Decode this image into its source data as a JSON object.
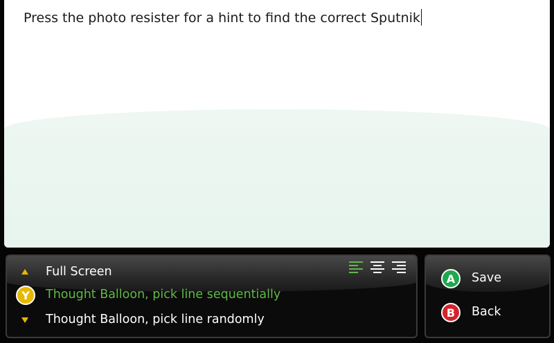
{
  "editor": {
    "text": "Press the photo resister for a hint to find the correct Sputnik"
  },
  "options": {
    "items": [
      {
        "label": "Full Screen",
        "marker": "arrow-up-icon",
        "selected": false
      },
      {
        "label": "Thought Balloon, pick line sequentially",
        "marker": "y-button-icon",
        "button_letter": "Y",
        "selected": true
      },
      {
        "label": "Thought Balloon, pick line randomly",
        "marker": "arrow-down-icon",
        "selected": false
      }
    ],
    "alignment": {
      "icons": [
        "align-left-icon",
        "align-center-icon",
        "align-right-icon"
      ],
      "active": "align-left-icon"
    }
  },
  "actions": {
    "save": {
      "letter": "A",
      "label": "Save"
    },
    "back": {
      "letter": "B",
      "label": "Back"
    }
  },
  "colors": {
    "selected_text": "#5fba46",
    "normal_text": "#ffffff",
    "accent_yellow": "#e8b800",
    "a_button": "#1fa84f",
    "b_button": "#d5232b",
    "align_active": "#5fba46",
    "align_inactive": "#ffffff"
  }
}
